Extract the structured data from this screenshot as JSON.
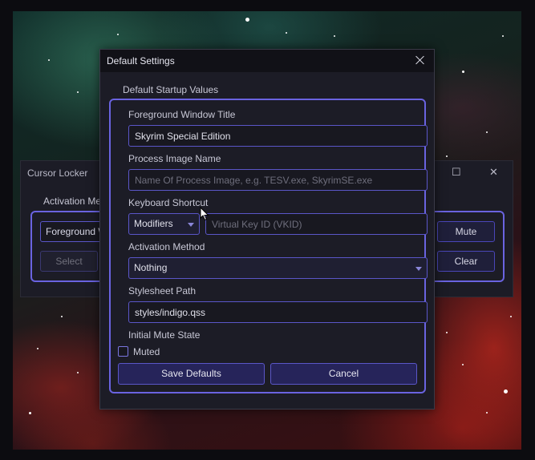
{
  "background_window": {
    "title": "Cursor Locker",
    "activation_label": "Activation Me",
    "foreground_field": "Foreground W",
    "select_button": "Select",
    "mute_button": "Mute",
    "clear_button": "Clear"
  },
  "dialog": {
    "title": "Default Settings",
    "group_title": "Default Startup Values",
    "foreground_window_title": {
      "label": "Foreground Window Title",
      "value": "Skyrim Special Edition"
    },
    "process_image_name": {
      "label": "Process Image Name",
      "placeholder": "Name Of Process Image, e.g. TESV.exe, SkyrimSE.exe"
    },
    "keyboard_shortcut": {
      "label": "Keyboard Shortcut",
      "modifiers": "Modifiers",
      "vkid_placeholder": "Virtual Key ID (VKID)"
    },
    "activation_method": {
      "label": "Activation Method",
      "selected": "Nothing"
    },
    "stylesheet_path": {
      "label": "Stylesheet Path",
      "value": "styles/indigo.qss"
    },
    "initial_mute_state": {
      "label": "Initial Mute State",
      "checkbox_label": "Muted",
      "checked": false
    },
    "save_button": "Save Defaults",
    "cancel_button": "Cancel"
  },
  "theme": {
    "accent": "#6a63e0",
    "window_bg": "#1c1c26",
    "field_bg": "#181820"
  }
}
